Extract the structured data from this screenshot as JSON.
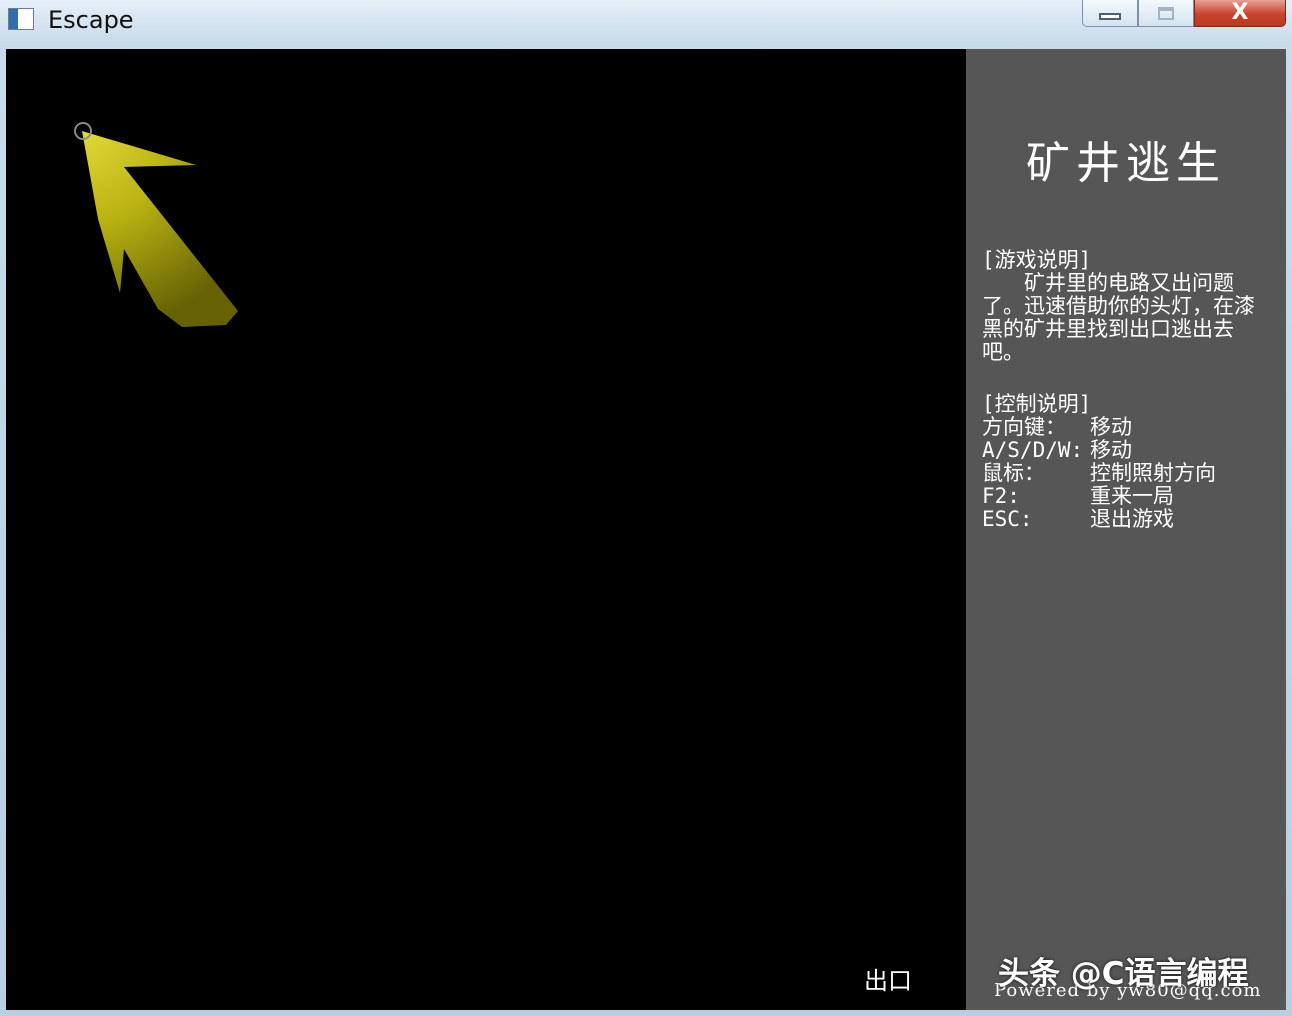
{
  "window": {
    "title": "Escape",
    "close_glyph": "X"
  },
  "game": {
    "exit_label": "出口",
    "colors": {
      "background": "#000000",
      "light_beam": "#e0d91f",
      "panel": "#565656"
    }
  },
  "panel": {
    "title": "矿井逃生",
    "intro_heading": "[游戏说明]",
    "intro_text": "矿井里的电路又出问题了。迅速借助你的头灯，在漆黑的矿井里找到出口逃出去吧。",
    "controls_heading": "[控制说明]",
    "controls": [
      {
        "key": "方向键：",
        "action": "移动"
      },
      {
        "key": "A/S/D/W:",
        "action": "移动"
      },
      {
        "key": "鼠标：",
        "action": "控制照射方向"
      },
      {
        "key": "F2:",
        "action": "重来一局"
      },
      {
        "key": "ESC:",
        "action": "退出游戏"
      }
    ],
    "credit": "Powered by yw80@qq.com"
  },
  "watermark": "头条 @C语言编程"
}
